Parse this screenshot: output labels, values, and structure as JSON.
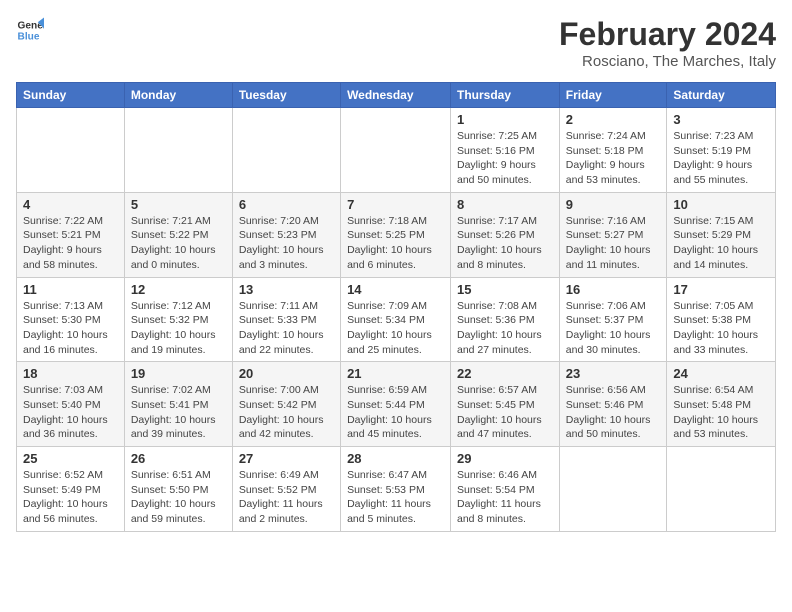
{
  "logo": {
    "line1": "General",
    "line2": "Blue"
  },
  "title": "February 2024",
  "subtitle": "Rosciano, The Marches, Italy",
  "columns": [
    "Sunday",
    "Monday",
    "Tuesday",
    "Wednesday",
    "Thursday",
    "Friday",
    "Saturday"
  ],
  "weeks": [
    [
      {
        "day": "",
        "info": ""
      },
      {
        "day": "",
        "info": ""
      },
      {
        "day": "",
        "info": ""
      },
      {
        "day": "",
        "info": ""
      },
      {
        "day": "1",
        "info": "Sunrise: 7:25 AM\nSunset: 5:16 PM\nDaylight: 9 hours\nand 50 minutes."
      },
      {
        "day": "2",
        "info": "Sunrise: 7:24 AM\nSunset: 5:18 PM\nDaylight: 9 hours\nand 53 minutes."
      },
      {
        "day": "3",
        "info": "Sunrise: 7:23 AM\nSunset: 5:19 PM\nDaylight: 9 hours\nand 55 minutes."
      }
    ],
    [
      {
        "day": "4",
        "info": "Sunrise: 7:22 AM\nSunset: 5:21 PM\nDaylight: 9 hours\nand 58 minutes."
      },
      {
        "day": "5",
        "info": "Sunrise: 7:21 AM\nSunset: 5:22 PM\nDaylight: 10 hours\nand 0 minutes."
      },
      {
        "day": "6",
        "info": "Sunrise: 7:20 AM\nSunset: 5:23 PM\nDaylight: 10 hours\nand 3 minutes."
      },
      {
        "day": "7",
        "info": "Sunrise: 7:18 AM\nSunset: 5:25 PM\nDaylight: 10 hours\nand 6 minutes."
      },
      {
        "day": "8",
        "info": "Sunrise: 7:17 AM\nSunset: 5:26 PM\nDaylight: 10 hours\nand 8 minutes."
      },
      {
        "day": "9",
        "info": "Sunrise: 7:16 AM\nSunset: 5:27 PM\nDaylight: 10 hours\nand 11 minutes."
      },
      {
        "day": "10",
        "info": "Sunrise: 7:15 AM\nSunset: 5:29 PM\nDaylight: 10 hours\nand 14 minutes."
      }
    ],
    [
      {
        "day": "11",
        "info": "Sunrise: 7:13 AM\nSunset: 5:30 PM\nDaylight: 10 hours\nand 16 minutes."
      },
      {
        "day": "12",
        "info": "Sunrise: 7:12 AM\nSunset: 5:32 PM\nDaylight: 10 hours\nand 19 minutes."
      },
      {
        "day": "13",
        "info": "Sunrise: 7:11 AM\nSunset: 5:33 PM\nDaylight: 10 hours\nand 22 minutes."
      },
      {
        "day": "14",
        "info": "Sunrise: 7:09 AM\nSunset: 5:34 PM\nDaylight: 10 hours\nand 25 minutes."
      },
      {
        "day": "15",
        "info": "Sunrise: 7:08 AM\nSunset: 5:36 PM\nDaylight: 10 hours\nand 27 minutes."
      },
      {
        "day": "16",
        "info": "Sunrise: 7:06 AM\nSunset: 5:37 PM\nDaylight: 10 hours\nand 30 minutes."
      },
      {
        "day": "17",
        "info": "Sunrise: 7:05 AM\nSunset: 5:38 PM\nDaylight: 10 hours\nand 33 minutes."
      }
    ],
    [
      {
        "day": "18",
        "info": "Sunrise: 7:03 AM\nSunset: 5:40 PM\nDaylight: 10 hours\nand 36 minutes."
      },
      {
        "day": "19",
        "info": "Sunrise: 7:02 AM\nSunset: 5:41 PM\nDaylight: 10 hours\nand 39 minutes."
      },
      {
        "day": "20",
        "info": "Sunrise: 7:00 AM\nSunset: 5:42 PM\nDaylight: 10 hours\nand 42 minutes."
      },
      {
        "day": "21",
        "info": "Sunrise: 6:59 AM\nSunset: 5:44 PM\nDaylight: 10 hours\nand 45 minutes."
      },
      {
        "day": "22",
        "info": "Sunrise: 6:57 AM\nSunset: 5:45 PM\nDaylight: 10 hours\nand 47 minutes."
      },
      {
        "day": "23",
        "info": "Sunrise: 6:56 AM\nSunset: 5:46 PM\nDaylight: 10 hours\nand 50 minutes."
      },
      {
        "day": "24",
        "info": "Sunrise: 6:54 AM\nSunset: 5:48 PM\nDaylight: 10 hours\nand 53 minutes."
      }
    ],
    [
      {
        "day": "25",
        "info": "Sunrise: 6:52 AM\nSunset: 5:49 PM\nDaylight: 10 hours\nand 56 minutes."
      },
      {
        "day": "26",
        "info": "Sunrise: 6:51 AM\nSunset: 5:50 PM\nDaylight: 10 hours\nand 59 minutes."
      },
      {
        "day": "27",
        "info": "Sunrise: 6:49 AM\nSunset: 5:52 PM\nDaylight: 11 hours\nand 2 minutes."
      },
      {
        "day": "28",
        "info": "Sunrise: 6:47 AM\nSunset: 5:53 PM\nDaylight: 11 hours\nand 5 minutes."
      },
      {
        "day": "29",
        "info": "Sunrise: 6:46 AM\nSunset: 5:54 PM\nDaylight: 11 hours\nand 8 minutes."
      },
      {
        "day": "",
        "info": ""
      },
      {
        "day": "",
        "info": ""
      }
    ]
  ]
}
